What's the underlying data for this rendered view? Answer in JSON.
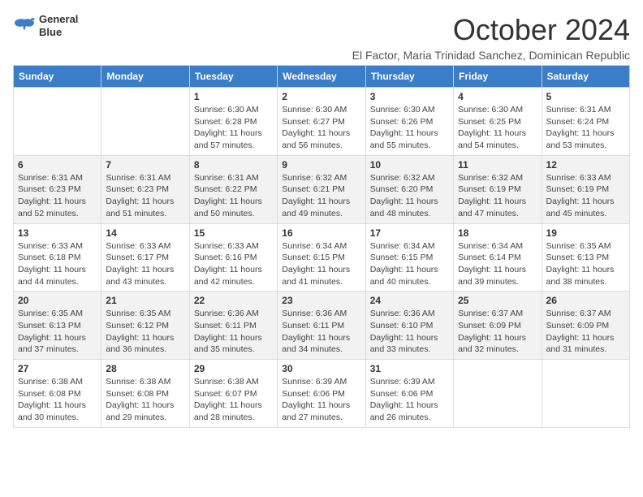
{
  "logo": {
    "line1": "General",
    "line2": "Blue"
  },
  "title": "October 2024",
  "subtitle": "El Factor, Maria Trinidad Sanchez, Dominican Republic",
  "header": {
    "days": [
      "Sunday",
      "Monday",
      "Tuesday",
      "Wednesday",
      "Thursday",
      "Friday",
      "Saturday"
    ]
  },
  "weeks": [
    [
      {
        "day": "",
        "info": ""
      },
      {
        "day": "",
        "info": ""
      },
      {
        "day": "1",
        "info": "Sunrise: 6:30 AM\nSunset: 6:28 PM\nDaylight: 11 hours and 57 minutes."
      },
      {
        "day": "2",
        "info": "Sunrise: 6:30 AM\nSunset: 6:27 PM\nDaylight: 11 hours and 56 minutes."
      },
      {
        "day": "3",
        "info": "Sunrise: 6:30 AM\nSunset: 6:26 PM\nDaylight: 11 hours and 55 minutes."
      },
      {
        "day": "4",
        "info": "Sunrise: 6:30 AM\nSunset: 6:25 PM\nDaylight: 11 hours and 54 minutes."
      },
      {
        "day": "5",
        "info": "Sunrise: 6:31 AM\nSunset: 6:24 PM\nDaylight: 11 hours and 53 minutes."
      }
    ],
    [
      {
        "day": "6",
        "info": "Sunrise: 6:31 AM\nSunset: 6:23 PM\nDaylight: 11 hours and 52 minutes."
      },
      {
        "day": "7",
        "info": "Sunrise: 6:31 AM\nSunset: 6:23 PM\nDaylight: 11 hours and 51 minutes."
      },
      {
        "day": "8",
        "info": "Sunrise: 6:31 AM\nSunset: 6:22 PM\nDaylight: 11 hours and 50 minutes."
      },
      {
        "day": "9",
        "info": "Sunrise: 6:32 AM\nSunset: 6:21 PM\nDaylight: 11 hours and 49 minutes."
      },
      {
        "day": "10",
        "info": "Sunrise: 6:32 AM\nSunset: 6:20 PM\nDaylight: 11 hours and 48 minutes."
      },
      {
        "day": "11",
        "info": "Sunrise: 6:32 AM\nSunset: 6:19 PM\nDaylight: 11 hours and 47 minutes."
      },
      {
        "day": "12",
        "info": "Sunrise: 6:33 AM\nSunset: 6:19 PM\nDaylight: 11 hours and 45 minutes."
      }
    ],
    [
      {
        "day": "13",
        "info": "Sunrise: 6:33 AM\nSunset: 6:18 PM\nDaylight: 11 hours and 44 minutes."
      },
      {
        "day": "14",
        "info": "Sunrise: 6:33 AM\nSunset: 6:17 PM\nDaylight: 11 hours and 43 minutes."
      },
      {
        "day": "15",
        "info": "Sunrise: 6:33 AM\nSunset: 6:16 PM\nDaylight: 11 hours and 42 minutes."
      },
      {
        "day": "16",
        "info": "Sunrise: 6:34 AM\nSunset: 6:15 PM\nDaylight: 11 hours and 41 minutes."
      },
      {
        "day": "17",
        "info": "Sunrise: 6:34 AM\nSunset: 6:15 PM\nDaylight: 11 hours and 40 minutes."
      },
      {
        "day": "18",
        "info": "Sunrise: 6:34 AM\nSunset: 6:14 PM\nDaylight: 11 hours and 39 minutes."
      },
      {
        "day": "19",
        "info": "Sunrise: 6:35 AM\nSunset: 6:13 PM\nDaylight: 11 hours and 38 minutes."
      }
    ],
    [
      {
        "day": "20",
        "info": "Sunrise: 6:35 AM\nSunset: 6:13 PM\nDaylight: 11 hours and 37 minutes."
      },
      {
        "day": "21",
        "info": "Sunrise: 6:35 AM\nSunset: 6:12 PM\nDaylight: 11 hours and 36 minutes."
      },
      {
        "day": "22",
        "info": "Sunrise: 6:36 AM\nSunset: 6:11 PM\nDaylight: 11 hours and 35 minutes."
      },
      {
        "day": "23",
        "info": "Sunrise: 6:36 AM\nSunset: 6:11 PM\nDaylight: 11 hours and 34 minutes."
      },
      {
        "day": "24",
        "info": "Sunrise: 6:36 AM\nSunset: 6:10 PM\nDaylight: 11 hours and 33 minutes."
      },
      {
        "day": "25",
        "info": "Sunrise: 6:37 AM\nSunset: 6:09 PM\nDaylight: 11 hours and 32 minutes."
      },
      {
        "day": "26",
        "info": "Sunrise: 6:37 AM\nSunset: 6:09 PM\nDaylight: 11 hours and 31 minutes."
      }
    ],
    [
      {
        "day": "27",
        "info": "Sunrise: 6:38 AM\nSunset: 6:08 PM\nDaylight: 11 hours and 30 minutes."
      },
      {
        "day": "28",
        "info": "Sunrise: 6:38 AM\nSunset: 6:08 PM\nDaylight: 11 hours and 29 minutes."
      },
      {
        "day": "29",
        "info": "Sunrise: 6:38 AM\nSunset: 6:07 PM\nDaylight: 11 hours and 28 minutes."
      },
      {
        "day": "30",
        "info": "Sunrise: 6:39 AM\nSunset: 6:06 PM\nDaylight: 11 hours and 27 minutes."
      },
      {
        "day": "31",
        "info": "Sunrise: 6:39 AM\nSunset: 6:06 PM\nDaylight: 11 hours and 26 minutes."
      },
      {
        "day": "",
        "info": ""
      },
      {
        "day": "",
        "info": ""
      }
    ]
  ]
}
